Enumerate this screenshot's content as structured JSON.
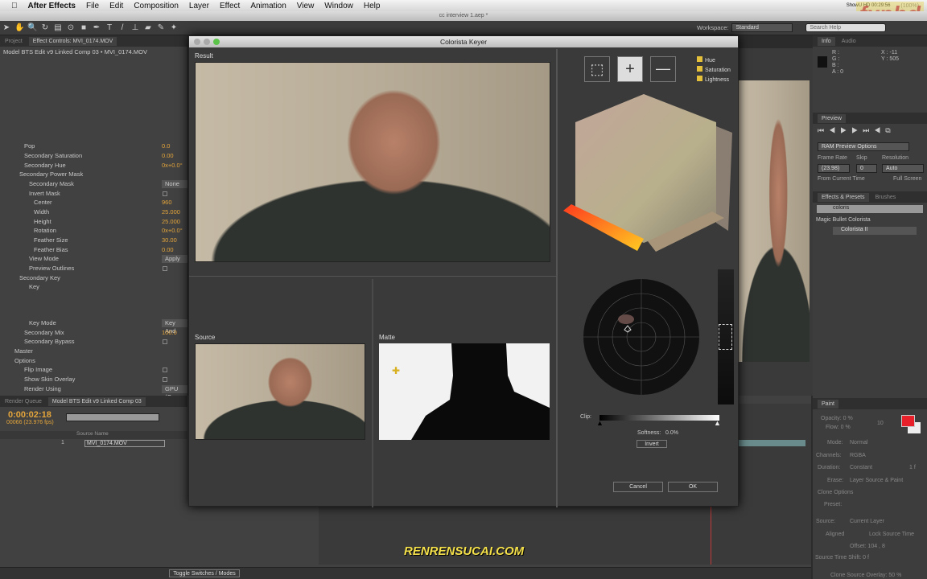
{
  "menubar": {
    "app": "After Effects",
    "items": [
      "File",
      "Edit",
      "Composition",
      "Layer",
      "Effect",
      "Animation",
      "View",
      "Window",
      "Help"
    ],
    "status": "ShowU HD 00:29:56",
    "battery": "(100%)"
  },
  "window_title": "cc interview 1.aep *",
  "toolbar": {
    "workspace_label": "Workspace:",
    "workspace_value": "Standard",
    "search_placeholder": "Search Help"
  },
  "left_panel": {
    "tabs": [
      "Project",
      "Effect Controls: MVI_0174.MOV"
    ],
    "breadcrumb": "Model BTS Edit v9 Linked Comp 03 • MVI_0174.MOV",
    "rows": [
      {
        "label": "Pop",
        "value": "0.0",
        "indent": 2
      },
      {
        "label": "Secondary Saturation",
        "value": "0.00",
        "indent": 2
      },
      {
        "label": "Secondary Hue",
        "value": "0x+0.0°",
        "indent": 2
      },
      {
        "label": "Secondary Power Mask",
        "indent": 1
      },
      {
        "label": "Secondary Mask",
        "box": "None",
        "indent": 3
      },
      {
        "label": "Invert Mask",
        "check": true,
        "indent": 3
      },
      {
        "label": "Center",
        "value": "960",
        "indent": 4
      },
      {
        "label": "Width",
        "value": "25.000",
        "indent": 4
      },
      {
        "label": "Height",
        "value": "25.000",
        "indent": 4
      },
      {
        "label": "Rotation",
        "value": "0x+0.0°",
        "indent": 4
      },
      {
        "label": "Feather Size",
        "value": "30.00",
        "indent": 4
      },
      {
        "label": "Feather Bias",
        "value": "0.00",
        "indent": 4
      },
      {
        "label": "View Mode",
        "box": "Apply",
        "indent": 3
      },
      {
        "label": "Preview Outlines",
        "check": true,
        "indent": 3
      },
      {
        "label": "Secondary Key",
        "indent": 1
      },
      {
        "label": "Key",
        "indent": 3
      },
      {
        "label": "",
        "indent": 0
      },
      {
        "label": "",
        "indent": 0
      },
      {
        "label": "",
        "indent": 0
      },
      {
        "label": "Key Mode",
        "box": "Key And",
        "indent": 3
      },
      {
        "label": "Secondary Mix",
        "value": "100.0",
        "indent": 2
      },
      {
        "label": "Secondary Bypass",
        "check": true,
        "indent": 2
      },
      {
        "label": "Master",
        "indent": 0
      },
      {
        "label": "Options",
        "indent": 0
      },
      {
        "label": "Flip Image",
        "check": true,
        "indent": 2
      },
      {
        "label": "Show Skin Overlay",
        "check": true,
        "indent": 2
      },
      {
        "label": "Render Using",
        "box": "GPU (O",
        "indent": 2
      }
    ]
  },
  "timeline": {
    "tabs": [
      "Render Queue",
      "Model BTS Edit v9 Linked Comp 03"
    ],
    "timecode": "0:00:02:18",
    "frames": "00066 (23.976 fps)",
    "column": "Source Name",
    "layer_num": "1",
    "layer_name": "MVI_0174.MOV",
    "toggle": "Toggle Switches / Modes"
  },
  "dialog": {
    "title": "Colorista Keyer",
    "result_label": "Result",
    "source_label": "Source",
    "matte_label": "Matte",
    "checks": [
      "Hue",
      "Saturation",
      "Lightness"
    ],
    "clip_label": "Clip:",
    "softness_label": "Softness:",
    "softness_value": "0.0%",
    "invert": "Invert",
    "cancel": "Cancel",
    "ok": "OK"
  },
  "info": {
    "tabs": [
      "Info",
      "Audio"
    ],
    "r": "R :",
    "g": "G :",
    "b": "B :",
    "a": "A : 0",
    "x": "X : -11",
    "y": "Y : 505"
  },
  "preview": {
    "tab": "Preview",
    "ram": "RAM Preview Options",
    "frame_rate_label": "Frame Rate",
    "skip_label": "Skip",
    "resolution_label": "Resolution",
    "frame_rate": "(23.98)",
    "skip": "0",
    "resolution": "Auto",
    "from_current": "From Current Time",
    "full_screen": "Full Screen"
  },
  "effects": {
    "tabs": [
      "Effects & Presets",
      "Brushes"
    ],
    "search": "coloris",
    "folder": "Magic Bullet Colorista",
    "item": "Colorista II"
  },
  "paint": {
    "tab": "Paint",
    "opacity": "Opacity: 0 %",
    "flow": "Flow: 0 %",
    "size": "10",
    "mode_label": "Mode:",
    "mode": "Normal",
    "channels_label": "Channels:",
    "channels": "RGBA",
    "duration_label": "Duration:",
    "duration": "Constant",
    "dur_val": "1 f",
    "erase_label": "Erase:",
    "erase": "Layer Source & Paint",
    "clone_options": "Clone Options",
    "preset_label": "Preset:",
    "source_label": "Source:",
    "source": "Current Layer",
    "aligned": "Aligned",
    "lock": "Lock Source Time",
    "offset": "Offset: 104 ,  8",
    "shift": "Source Time Shift: 0 f",
    "overlay": "Clone Source Overlay: 50 %",
    "fg_color": "#e8202a"
  },
  "watermarks": [
    "fxphd",
    "RENRENSUCAI.COM"
  ]
}
